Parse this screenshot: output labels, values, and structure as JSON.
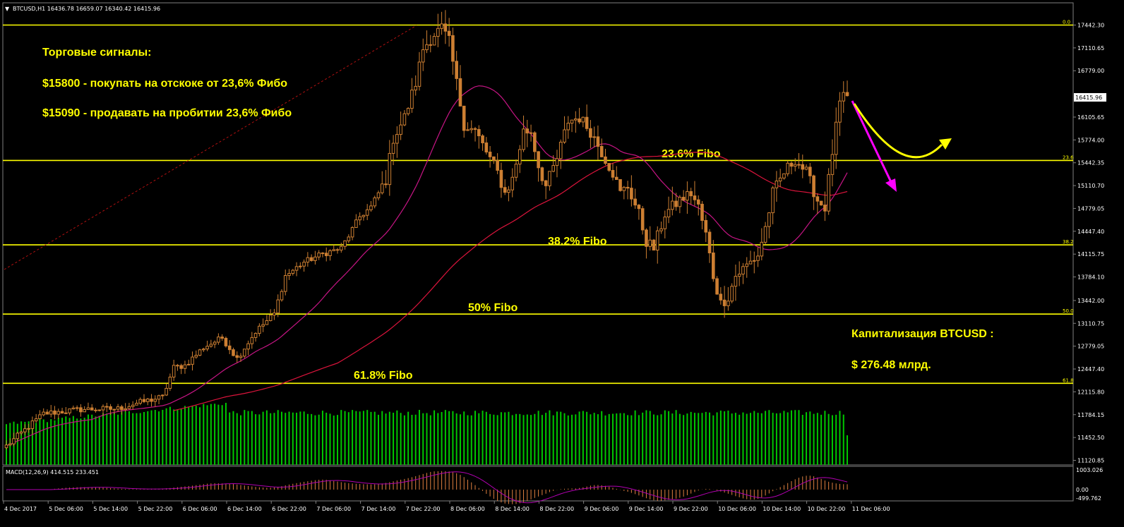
{
  "symbol_info": "BTCUSD,H1  16436.78 16659.07 16340.42 16415.96",
  "colors": {
    "background": "#000000",
    "frame": "#808080",
    "grid_text": "#ffffff",
    "fib": "#ffff00",
    "candle": "#cd7f32",
    "ma_fast": "#c71585",
    "ma_slow": "#dc143c",
    "volume": "#00c800",
    "macd_hist": "#e08040",
    "macd_signal": "#b000b0",
    "trend_line": "#b01010",
    "arrow_down": "#ff00ff",
    "arrow_curve": "#ffff00"
  },
  "annotations": {
    "signals_title": "Торговые сигналы:",
    "signal_buy": "$15800 - покупать на отскоке от  23,6% Фибо",
    "signal_sell": "$15090 - продавать на пробитии 23,6% Фибо",
    "cap_label": "Капитализация BTCUSD :",
    "cap_value": "$ 276.48 млрд."
  },
  "chart_data": {
    "type": "candlestick",
    "instrument": "BTCUSD",
    "timeframe": "H1",
    "ohlc_last": {
      "open": 16436.78,
      "high": 16659.07,
      "low": 16340.42,
      "close": 16415.96
    },
    "current_price_label": "16415.96",
    "y_axis_ticks": [
      "17442.30",
      "17110.65",
      "16779.00",
      "16105.65",
      "15774.00",
      "15442.35",
      "15110.70",
      "14779.05",
      "14447.40",
      "14115.75",
      "13784.10",
      "13442.00",
      "13110.75",
      "12779.05",
      "12447.40",
      "12115.80",
      "11784.15",
      "11452.50",
      "11120.85"
    ],
    "y_axis_tick_values": [
      17442.3,
      17110.65,
      16779.0,
      16105.65,
      15774.0,
      15442.35,
      15110.7,
      14779.05,
      14447.4,
      14115.75,
      13784.1,
      13442.0,
      13110.75,
      12779.05,
      12447.4,
      12115.8,
      11784.15,
      11452.5,
      11120.85
    ],
    "ylim": [
      11120.85,
      17442.3
    ],
    "x_axis_labels": [
      "4 Dec 2017",
      "5 Dec 06:00",
      "5 Dec 14:00",
      "5 Dec 22:00",
      "6 Dec 06:00",
      "6 Dec 14:00",
      "6 Dec 22:00",
      "7 Dec 06:00",
      "7 Dec 14:00",
      "7 Dec 22:00",
      "8 Dec 06:00",
      "8 Dec 14:00",
      "8 Dec 22:00",
      "9 Dec 06:00",
      "9 Dec 14:00",
      "9 Dec 22:00",
      "10 Dec 06:00",
      "10 Dec 14:00",
      "10 Dec 22:00",
      "11 Dec 06:00"
    ],
    "fib_levels": [
      {
        "tag": "0.0",
        "price": 17442.3,
        "label": ""
      },
      {
        "tag": "23.6",
        "price": 15476,
        "label": "23.6% Fibo"
      },
      {
        "tag": "38.2",
        "price": 14250,
        "label": "38.2% Fibo"
      },
      {
        "tag": "50.0",
        "price": 13245,
        "label": "50% Fibo"
      },
      {
        "tag": "61.8",
        "price": 12240,
        "label": "61.8% Fibo"
      }
    ],
    "macd": {
      "label": "MACD(12,26,9) 414.515 233.451",
      "ticks": [
        "1003.026",
        "0.00",
        "-499.762"
      ],
      "tick_values": [
        1003.026,
        0.0,
        -499.762
      ],
      "range": [
        -499.762,
        1003.026
      ]
    },
    "price_path_anchors": [
      [
        0,
        11330
      ],
      [
        10,
        11800
      ],
      [
        20,
        11860
      ],
      [
        30,
        11870
      ],
      [
        35,
        11950
      ],
      [
        42,
        12040
      ],
      [
        45,
        12470
      ],
      [
        48,
        12500
      ],
      [
        53,
        12760
      ],
      [
        58,
        12900
      ],
      [
        62,
        12600
      ],
      [
        67,
        12990
      ],
      [
        72,
        13250
      ],
      [
        75,
        13800
      ],
      [
        80,
        14000
      ],
      [
        85,
        14120
      ],
      [
        90,
        14200
      ],
      [
        95,
        14660
      ],
      [
        98,
        14800
      ],
      [
        102,
        15200
      ],
      [
        104,
        15800
      ],
      [
        107,
        16100
      ],
      [
        110,
        16600
      ],
      [
        112,
        17100
      ],
      [
        115,
        17310
      ],
      [
        117,
        17400
      ],
      [
        119,
        17200
      ],
      [
        121,
        16600
      ],
      [
        123,
        16000
      ],
      [
        126,
        15900
      ],
      [
        129,
        15600
      ],
      [
        132,
        15300
      ],
      [
        134,
        15000
      ],
      [
        136,
        15200
      ],
      [
        139,
        15900
      ],
      [
        141,
        15900
      ],
      [
        143,
        15400
      ],
      [
        145,
        15100
      ],
      [
        148,
        15500
      ],
      [
        151,
        16050
      ],
      [
        154,
        16100
      ],
      [
        157,
        15900
      ],
      [
        160,
        15600
      ],
      [
        163,
        15300
      ],
      [
        165,
        15000
      ],
      [
        167,
        15100
      ],
      [
        170,
        14700
      ],
      [
        172,
        14300
      ],
      [
        174,
        14200
      ],
      [
        177,
        14700
      ],
      [
        181,
        14900
      ],
      [
        184,
        15000
      ],
      [
        186,
        14800
      ],
      [
        188,
        14400
      ],
      [
        190,
        13800
      ],
      [
        192,
        13400
      ],
      [
        194,
        13500
      ],
      [
        196,
        13800
      ],
      [
        198,
        13900
      ],
      [
        200,
        14000
      ],
      [
        202,
        14100
      ],
      [
        204,
        14500
      ],
      [
        206,
        15000
      ],
      [
        209,
        15300
      ],
      [
        212,
        15500
      ],
      [
        215,
        15300
      ],
      [
        218,
        14900
      ],
      [
        220,
        14800
      ],
      [
        222,
        15600
      ],
      [
        224,
        16300
      ],
      [
        226,
        16450
      ]
    ]
  }
}
